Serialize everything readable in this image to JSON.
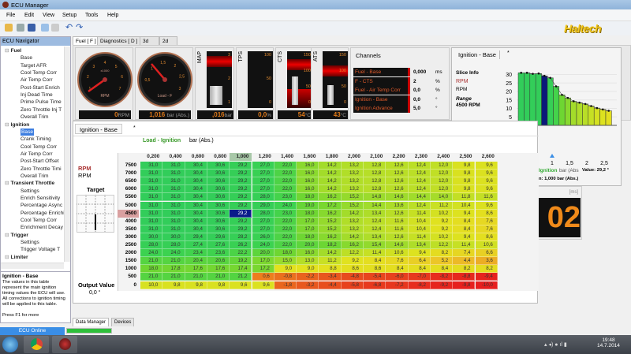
{
  "window": {
    "title": "ECU Manager"
  },
  "menu": [
    "File",
    "Edit",
    "View",
    "Setup",
    "Tools",
    "Help"
  ],
  "toolbar": [
    "open-icon",
    "edit-icon",
    "save-icon",
    "copy-icon",
    "paste-icon",
    "undo-icon",
    "redo-icon"
  ],
  "brand": {
    "logo": "Haltech",
    "color": "#f2c61a"
  },
  "navigator": {
    "title": "ECU Navigator",
    "items": [
      {
        "label": "Fuel",
        "group": true
      },
      {
        "label": "Base"
      },
      {
        "label": "Target AFR"
      },
      {
        "label": "Cool Temp Corr"
      },
      {
        "label": "Air Temp Corr"
      },
      {
        "label": "Post-Start Enrich"
      },
      {
        "label": "Inj Dead Time"
      },
      {
        "label": "Prime Pulse Time"
      },
      {
        "label": "Zero Throttle Inj T"
      },
      {
        "label": "Overall Trim"
      },
      {
        "label": "Ignition",
        "group": true
      },
      {
        "label": "Base",
        "selected": true
      },
      {
        "label": "Crank Timing"
      },
      {
        "label": "Cool Temp Corr"
      },
      {
        "label": "Air Temp Corr"
      },
      {
        "label": "Post-Start Offset"
      },
      {
        "label": "Zero Throttle Timi"
      },
      {
        "label": "Overall Trim"
      },
      {
        "label": "Transient Throttle",
        "group": true
      },
      {
        "label": "Settings"
      },
      {
        "label": "Enrich Sensitivity"
      },
      {
        "label": "Percentage Async"
      },
      {
        "label": "Percentage Enrichi"
      },
      {
        "label": "Cool Temp Corr"
      },
      {
        "label": "Enrichment Decay"
      },
      {
        "label": "Trigger",
        "group": true
      },
      {
        "label": "Settings"
      },
      {
        "label": "Trigger Voltage T"
      },
      {
        "label": "Limiter",
        "group": true
      }
    ]
  },
  "description": {
    "title": "Ignition - Base",
    "body": "The values in this table represent the main ignition timing values the ECU will use. All corrections to ignition timing will be applied to this table.",
    "footer": "Press F1 for more"
  },
  "tabs": [
    "Fuel [ F ]",
    "Diagnostics [ D ]",
    "3d",
    "2d"
  ],
  "gauges": {
    "rpm": {
      "label": "RPM",
      "scale": "x1000",
      "ticks": [
        "1",
        "2",
        "3",
        "4",
        "5",
        "6",
        "7"
      ],
      "readout": "0",
      "unit": "RPM"
    },
    "load": {
      "label": "Load - F",
      "ticks": [
        "0,5",
        "1",
        "1,5",
        "2",
        "2,5",
        "3"
      ],
      "readout": "1,016",
      "unit": "bar (Abs.)"
    },
    "map": {
      "label": "MAP",
      "ticks": [
        "3",
        "2",
        "1"
      ],
      "readout": ",016",
      "unit": "bar (Abs.)"
    },
    "tps": {
      "label": "TPS",
      "ticks": [
        "100",
        "50",
        "0"
      ],
      "readout": "0,0",
      "unit": "%"
    },
    "cts": {
      "label": "CTS",
      "ticks": [
        "150",
        "100",
        "50",
        "0"
      ],
      "readout": "54",
      "unit": "°C"
    },
    "ats": {
      "label": "ATS",
      "ticks": [
        "150",
        "100",
        "50",
        "0"
      ],
      "readout": "43",
      "unit": "°C"
    }
  },
  "channels": {
    "title": "Channels",
    "rows": [
      {
        "name": "Fuel - Base",
        "value": "0,000",
        "unit": "ms"
      },
      {
        "name": "F - CTS",
        "value": "2",
        "unit": "%"
      },
      {
        "name": "Fuel - Air Temp Corr",
        "value": "0,0",
        "unit": "%"
      },
      {
        "name": "Ignition - Base",
        "value": "0,0",
        "unit": "°"
      },
      {
        "name": "Ignition Advance",
        "value": "5,0",
        "unit": "°"
      }
    ]
  },
  "slice": {
    "tab": "Ignition - Base",
    "tab2": "*",
    "info_title": "Slice Info",
    "axis": "RPM",
    "axis2": "RPM",
    "range_label": "Range",
    "range": "4500 RPM",
    "yticks": [
      "30",
      "25",
      "20",
      "15",
      "10",
      "5"
    ],
    "xticks": [
      "1",
      "1,5",
      "2",
      "2,5"
    ],
    "values": [
      31.0,
      31.0,
      30.4,
      30.6,
      29.2,
      28.0,
      23.0,
      18.0,
      16.2,
      14.2,
      13.4,
      12.6,
      11.4,
      10.2,
      9.4,
      8.6
    ],
    "selected_index": 4,
    "footer1_a": "Ignition",
    "footer1_b": "bar (Abs",
    "footer1_c": "Value: 29,2 °",
    "footer2": "n: 1,000 bar (Abs.)"
  },
  "digital": {
    "unit": "[ms]",
    "value": "02"
  },
  "ignition": {
    "tab": "Ignition - Base",
    "tab2": "*",
    "load_label": "Load - Ignition",
    "load_unit": "bar (Abs.)",
    "rpm_label": "RPM",
    "rpm_unit": "RPM",
    "target_label": "Target",
    "output_label": "Output Value",
    "output_value": "0,0 °",
    "columns": [
      "0,200",
      "0,400",
      "0,600",
      "0,800",
      "1,000",
      "1,200",
      "1,400",
      "1,600",
      "1,800",
      "2,000",
      "2,100",
      "2,200",
      "2,300",
      "2,400",
      "2,500",
      "2,600"
    ],
    "rows": [
      "7500",
      "7000",
      "6500",
      "6000",
      "5500",
      "5000",
      "4500",
      "4000",
      "3500",
      "3000",
      "2500",
      "2000",
      "1500",
      "1000",
      "500",
      "0"
    ],
    "active_row": "4500",
    "active_col": "1,000",
    "values": [
      [
        31.0,
        31.0,
        30.4,
        30.6,
        29.2,
        27.0,
        22.0,
        16.0,
        14.2,
        13.2,
        12.8,
        12.6,
        12.4,
        12.0,
        9.8,
        9.6
      ],
      [
        31.0,
        31.0,
        30.4,
        30.6,
        29.2,
        27.0,
        22.0,
        16.0,
        14.2,
        13.2,
        12.8,
        12.6,
        12.4,
        12.0,
        9.8,
        9.6
      ],
      [
        31.0,
        31.0,
        30.4,
        30.6,
        29.2,
        27.0,
        22.0,
        16.0,
        14.2,
        13.2,
        12.8,
        12.6,
        12.4,
        12.0,
        9.8,
        9.6
      ],
      [
        31.0,
        31.0,
        30.4,
        30.6,
        29.2,
        27.0,
        22.0,
        16.0,
        14.2,
        13.2,
        12.8,
        12.6,
        12.4,
        12.0,
        9.8,
        9.6
      ],
      [
        31.0,
        31.0,
        30.4,
        30.6,
        29.2,
        28.0,
        23.0,
        18.0,
        16.2,
        15.2,
        14.8,
        14.6,
        14.4,
        14.0,
        11.8,
        11.6
      ],
      [
        31.0,
        31.0,
        30.4,
        30.6,
        29.2,
        29.0,
        24.0,
        19.0,
        17.2,
        15.2,
        14.4,
        13.6,
        12.4,
        11.2,
        10.4,
        9.6
      ],
      [
        31.0,
        31.0,
        30.4,
        30.6,
        29.2,
        28.0,
        23.0,
        18.0,
        16.2,
        14.2,
        13.4,
        12.6,
        11.4,
        10.2,
        9.4,
        8.6
      ],
      [
        31.0,
        31.0,
        30.4,
        30.6,
        29.2,
        27.0,
        22.0,
        17.0,
        15.2,
        13.2,
        12.4,
        11.6,
        10.4,
        9.2,
        8.4,
        7.6
      ],
      [
        31.0,
        31.0,
        30.4,
        30.6,
        29.2,
        27.0,
        22.0,
        17.0,
        15.2,
        13.2,
        12.4,
        11.6,
        10.4,
        9.2,
        8.4,
        7.6
      ],
      [
        30.0,
        30.0,
        29.4,
        29.6,
        28.2,
        26.0,
        22.0,
        18.0,
        16.2,
        14.2,
        13.4,
        12.6,
        11.4,
        10.2,
        9.4,
        8.6
      ],
      [
        28.0,
        28.0,
        27.4,
        27.6,
        26.2,
        24.0,
        22.0,
        20.0,
        18.2,
        16.2,
        15.4,
        14.6,
        13.4,
        12.2,
        11.4,
        10.6
      ],
      [
        24.0,
        24.0,
        23.4,
        23.6,
        22.2,
        20.0,
        18.0,
        16.0,
        14.2,
        12.2,
        11.4,
        10.6,
        9.4,
        8.2,
        7.4,
        6.6
      ],
      [
        21.0,
        21.0,
        20.4,
        20.6,
        19.2,
        17.0,
        15.0,
        13.0,
        11.2,
        9.2,
        8.4,
        7.6,
        6.4,
        5.2,
        4.4,
        3.6
      ],
      [
        18.0,
        17.8,
        17.6,
        17.6,
        17.4,
        17.2,
        9.0,
        9.0,
        8.8,
        8.6,
        8.6,
        8.4,
        8.4,
        8.4,
        8.2,
        8.2
      ],
      [
        21.0,
        21.0,
        21.0,
        21.0,
        21.2,
        0.6,
        -0.8,
        -2.2,
        -3.4,
        -4.8,
        -5.4,
        -6.0,
        -7.0,
        -8.2,
        -8.8,
        -9.4
      ],
      [
        10.0,
        9.8,
        9.8,
        9.8,
        9.6,
        9.6,
        -1.8,
        -3.2,
        -4.4,
        -5.8,
        -6.8,
        -7.2,
        -8.2,
        -9.2,
        -9.8,
        -10.0
      ]
    ]
  },
  "bottom_tabs": [
    "Data Manager",
    "Devices"
  ],
  "status": {
    "text": "ECU Online",
    "color": "#3a8ee6",
    "progress": 1.0
  },
  "taskbar": {
    "time": "19:48",
    "date": "14.7.2014"
  }
}
